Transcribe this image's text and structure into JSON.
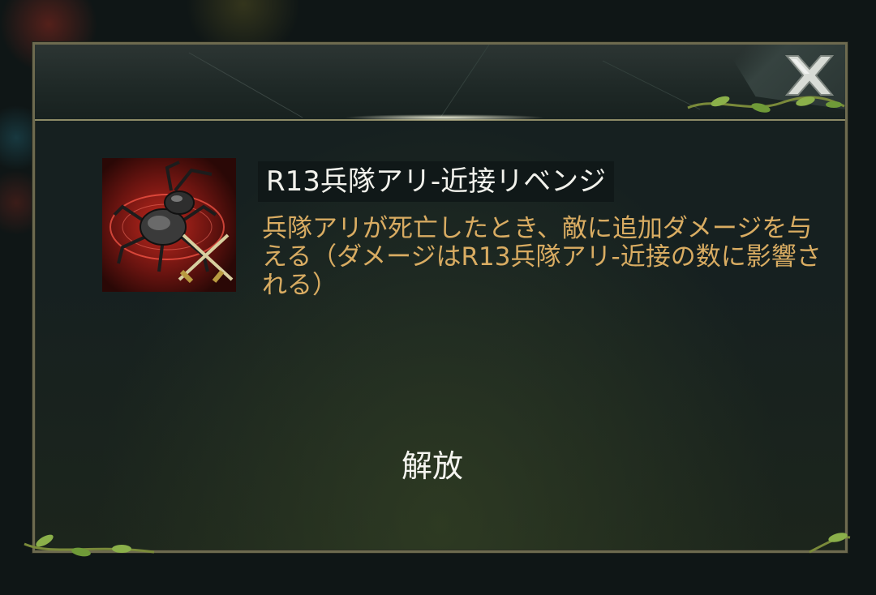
{
  "skill": {
    "title": "R13兵隊アリ-近接リベンジ",
    "description": "兵隊アリが死亡したとき、敵に追加ダメージを与える（ダメージはR13兵隊アリ-近接の数に影響される）",
    "icon": "soldier-ant-melee-revenge-icon"
  },
  "actions": {
    "unlock_label": "解放",
    "close_icon": "close-icon"
  },
  "colors": {
    "title_text": "#f2f2ec",
    "description_text": "#d9ac62",
    "border": "#6d6a4f",
    "panel": "#162020"
  }
}
